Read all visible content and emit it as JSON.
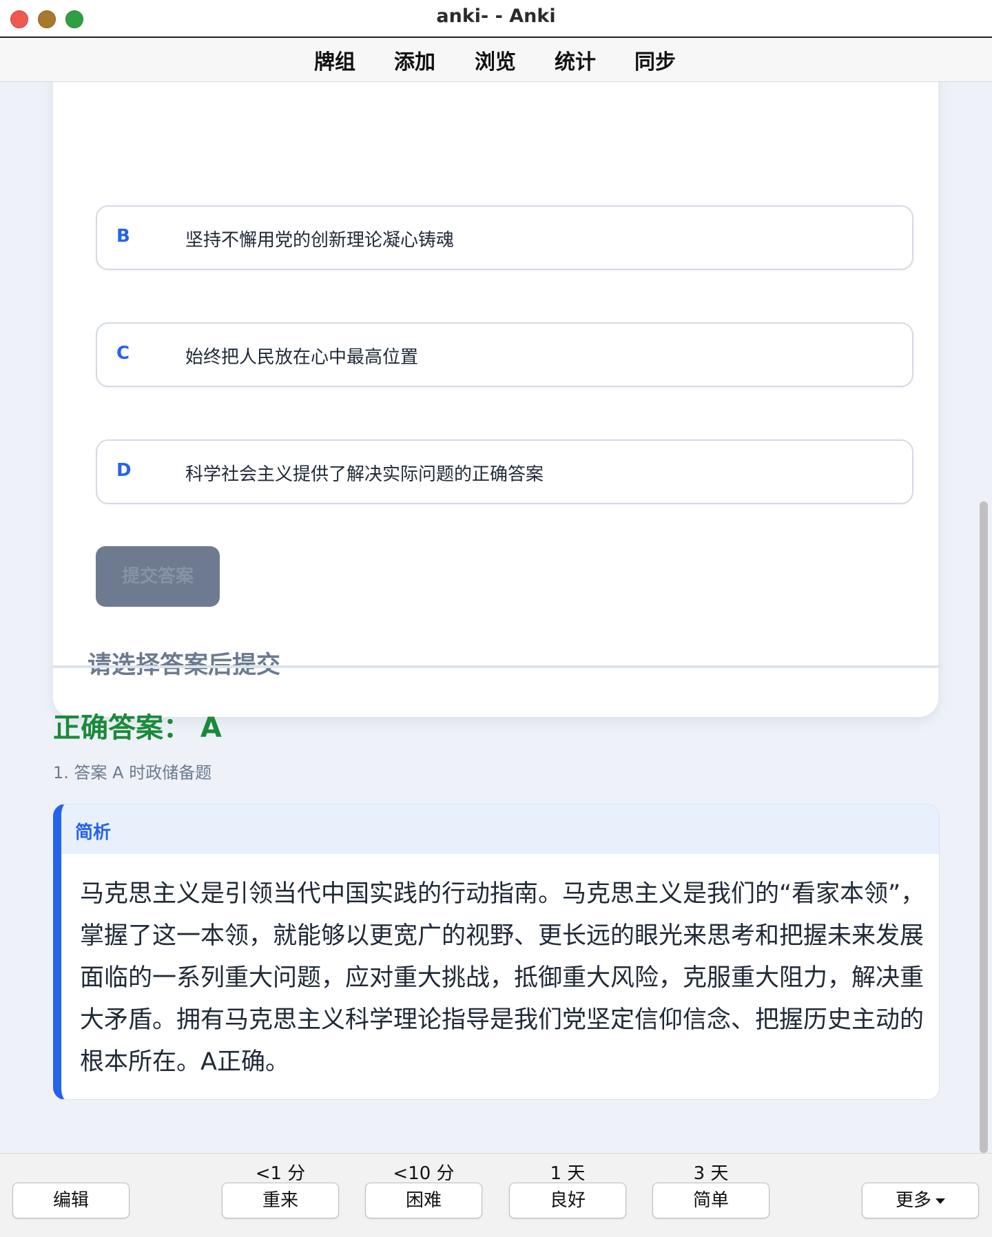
{
  "window": {
    "title": "anki- - Anki"
  },
  "menu": {
    "items": [
      "牌组",
      "添加",
      "浏览",
      "统计",
      "同步"
    ]
  },
  "question": {
    "options": [
      {
        "letter": "B",
        "text": "坚持不懈用党的创新理论凝心铸魂"
      },
      {
        "letter": "C",
        "text": "始终把人民放在心中最高位置"
      },
      {
        "letter": "D",
        "text": "科学社会主义提供了解决实际问题的正确答案"
      }
    ],
    "submit_label": "提交答案",
    "hint": "请选择答案后提交"
  },
  "answer": {
    "correct": "正确答案： A",
    "note": "1. 答案 A 时政储备题",
    "analysis_title": "简析",
    "analysis_body": "马克思主义是引领当代中国实践的行动指南。马克思主义是我们的“看家本领”，掌握了这一本领，就能够以更宽广的视野、更长远的眼光来思考和把握未来发展面临的一系列重大问题，应对重大挑战，抵御重大风险，克服重大阻力，解决重大矛盾。拥有马克思主义科学理论指导是我们党坚定信仰信念、把握历史主动的根本所在。A正确。"
  },
  "bottombar": {
    "edit_label": "编辑",
    "more_label": "更多",
    "ease_buttons": [
      {
        "interval": "<1 分",
        "label": "重来"
      },
      {
        "interval": "<10 分",
        "label": "困难"
      },
      {
        "interval": "1 天",
        "label": "良好"
      },
      {
        "interval": "3 天",
        "label": "简单"
      }
    ]
  },
  "colors": {
    "accent": "#2563eb",
    "correct": "#1a8a3a",
    "background": "#eef2f8"
  }
}
